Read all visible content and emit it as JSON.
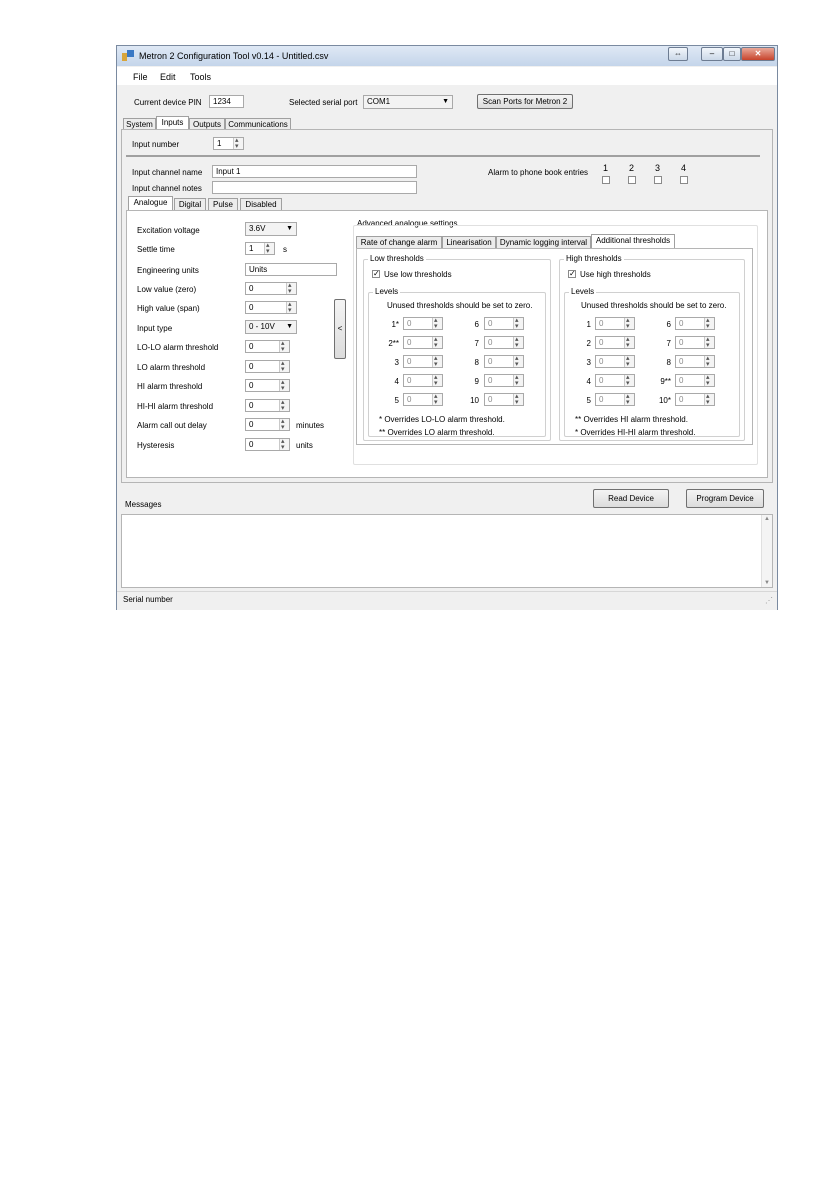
{
  "window": {
    "title": "Metron 2 Configuration Tool v0.14 - Untitled.csv"
  },
  "menu": {
    "file": "File",
    "edit": "Edit",
    "tools": "Tools"
  },
  "top": {
    "pin_label": "Current device PIN",
    "pin_value": "1234",
    "port_label": "Selected serial port",
    "port_value": "COM1",
    "scan_button": "Scan Ports for Metron 2"
  },
  "main_tabs": {
    "system": "System",
    "inputs": "Inputs",
    "outputs": "Outputs",
    "communications": "Communications"
  },
  "input": {
    "number_label": "Input number",
    "number_value": "1",
    "name_label": "Input channel name",
    "name_value": "Input 1",
    "notes_label": "Input channel notes",
    "notes_value": "",
    "alarm_label": "Alarm to phone book entries",
    "alarm_cols": [
      "1",
      "2",
      "3",
      "4"
    ]
  },
  "type_tabs": {
    "analogue": "Analogue",
    "digital": "Digital",
    "pulse": "Pulse",
    "disabled": "Disabled"
  },
  "analogue": {
    "excitation_label": "Excitation voltage",
    "excitation_value": "3.6V",
    "settle_label": "Settle time",
    "settle_value": "1",
    "settle_unit": "s",
    "eng_units_label": "Engineering units",
    "eng_units_value": "Units",
    "low_label": "Low value (zero)",
    "low_value": "0",
    "high_label": "High value (span)",
    "high_value": "0",
    "input_type_label": "Input type",
    "input_type_value": "0 - 10V",
    "lolo_label": "LO-LO alarm threshold",
    "lolo_value": "0",
    "lo_label": "LO alarm threshold",
    "lo_value": "0",
    "hi_label": "HI alarm threshold",
    "hi_value": "0",
    "hihi_label": "HI-HI alarm threshold",
    "hihi_value": "0",
    "delay_label": "Alarm call out delay",
    "delay_value": "0",
    "delay_unit": "minutes",
    "hyst_label": "Hysteresis",
    "hyst_value": "0",
    "hyst_unit": "units",
    "collapse_button": "<"
  },
  "advanced": {
    "title": "Advanced analogue settings",
    "tabs": {
      "roc": "Rate of change alarm",
      "lin": "Linearisation",
      "dyn": "Dynamic logging interval",
      "add": "Additional thresholds"
    },
    "low": {
      "title": "Low thresholds",
      "use_label": "Use low thresholds",
      "levels": "Levels",
      "note": "Unused thresholds should be set to zero.",
      "left": [
        {
          "label": "1*",
          "value": "0"
        },
        {
          "label": "2**",
          "value": "0"
        },
        {
          "label": "3",
          "value": "0"
        },
        {
          "label": "4",
          "value": "0"
        },
        {
          "label": "5",
          "value": "0"
        }
      ],
      "right": [
        {
          "label": "6",
          "value": "0"
        },
        {
          "label": "7",
          "value": "0"
        },
        {
          "label": "8",
          "value": "0"
        },
        {
          "label": "9",
          "value": "0"
        },
        {
          "label": "10",
          "value": "0"
        }
      ],
      "foot1": "* Overrides LO-LO alarm threshold.",
      "foot2": "** Overrides LO alarm threshold."
    },
    "high": {
      "title": "High thresholds",
      "use_label": "Use high thresholds",
      "levels": "Levels",
      "note": "Unused thresholds should be set to zero.",
      "left": [
        {
          "label": "1",
          "value": "0"
        },
        {
          "label": "2",
          "value": "0"
        },
        {
          "label": "3",
          "value": "0"
        },
        {
          "label": "4",
          "value": "0"
        },
        {
          "label": "5",
          "value": "0"
        }
      ],
      "right": [
        {
          "label": "6",
          "value": "0"
        },
        {
          "label": "7",
          "value": "0"
        },
        {
          "label": "8",
          "value": "0"
        },
        {
          "label": "9**",
          "value": "0"
        },
        {
          "label": "10*",
          "value": "0"
        }
      ],
      "foot1": "** Overrides HI alarm threshold.",
      "foot2": "* Overrides HI-HI alarm threshold."
    }
  },
  "bottom": {
    "messages": "Messages",
    "read_button": "Read Device",
    "program_button": "Program Device",
    "status": "Serial number"
  },
  "colors": {
    "title_bar": "#c4d5ea",
    "window_bg": "#f0f0f0",
    "close_button": "#c7442c"
  }
}
